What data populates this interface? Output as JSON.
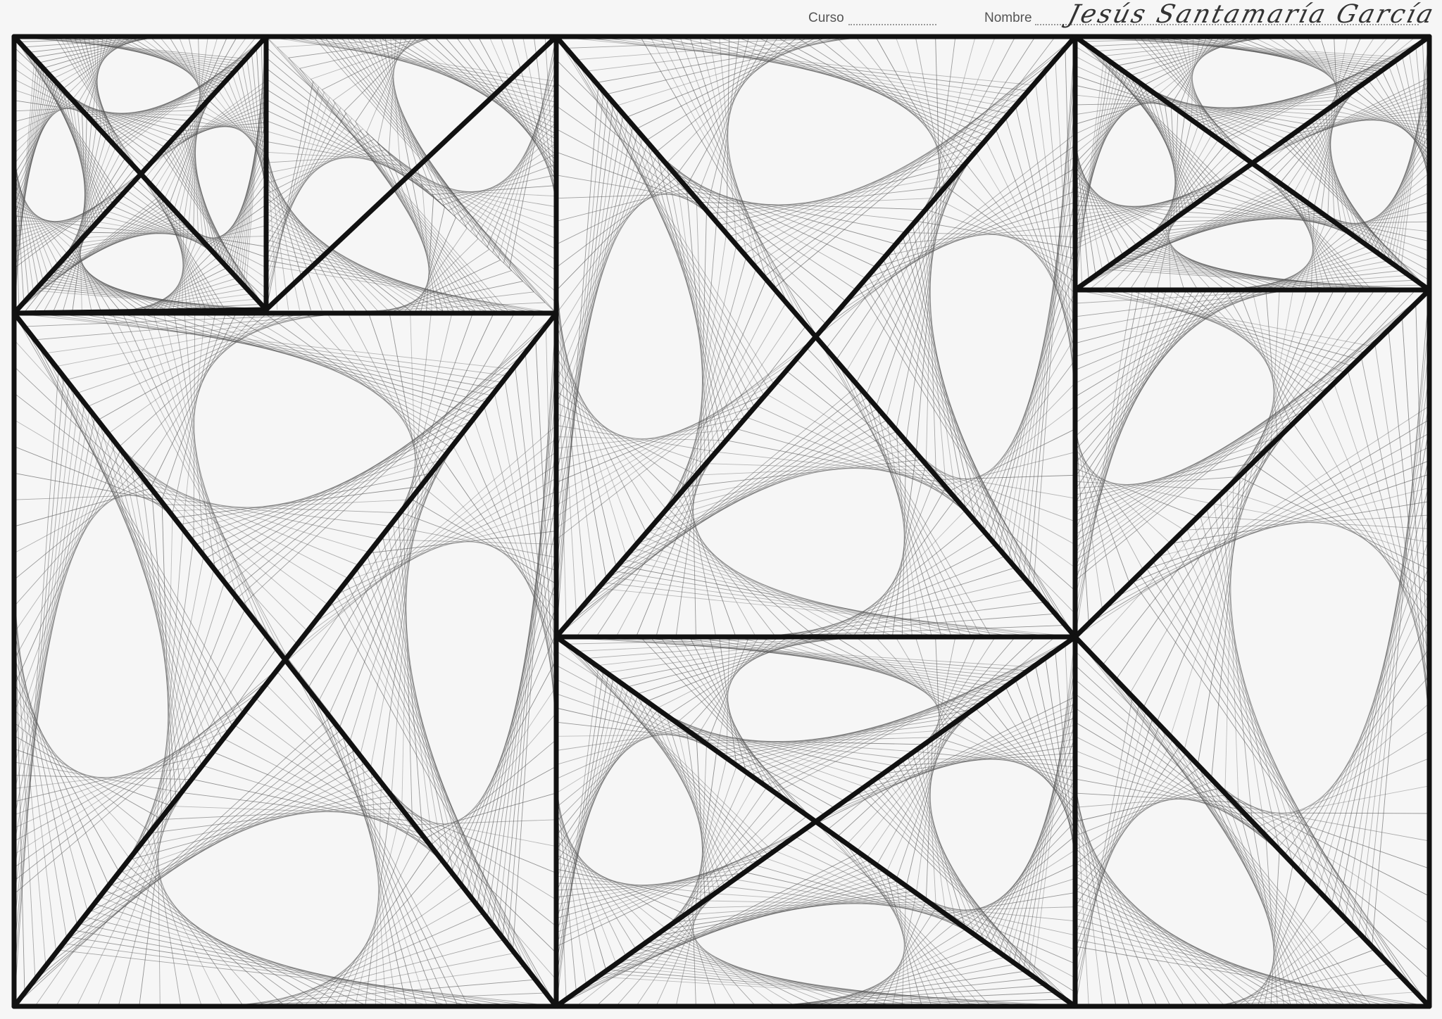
{
  "header": {
    "course_label": "Curso",
    "name_label": "Nombre",
    "signature_text": "Jesús Santamaría García"
  },
  "artwork": {
    "ink_color": "#111111",
    "hatch_color": "#555555",
    "paper_color": "#f6f6f6"
  }
}
